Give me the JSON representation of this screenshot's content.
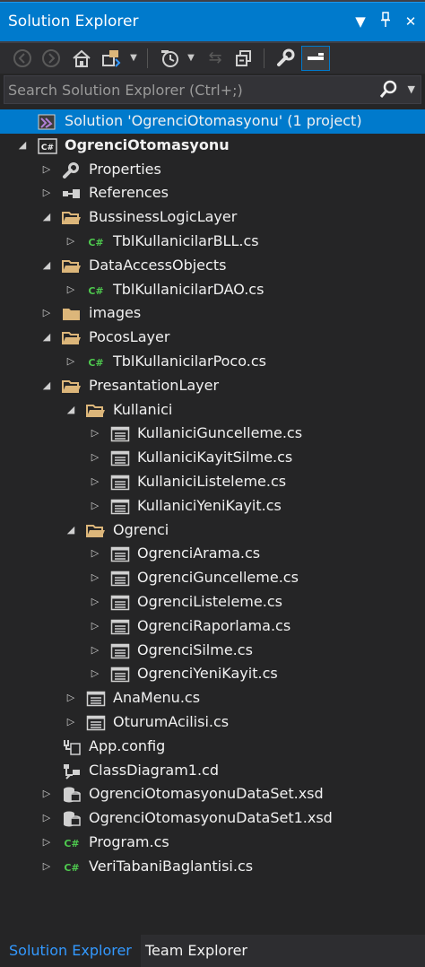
{
  "window": {
    "title": "Solution Explorer"
  },
  "search": {
    "placeholder": "Search Solution Explorer (Ctrl+;)"
  },
  "tree": [
    {
      "label": "Solution 'OgrenciOtomasyonu' (1 project)",
      "icon": "solution-icon",
      "expander": "none",
      "depth": 0,
      "selected": true
    },
    {
      "label": "OgrenciOtomasyonu",
      "icon": "csharp-project-icon",
      "expander": "expanded",
      "depth": 0,
      "bold": true
    },
    {
      "label": "Properties",
      "icon": "wrench-icon",
      "expander": "collapsed",
      "depth": 1
    },
    {
      "label": "References",
      "icon": "references-icon",
      "expander": "collapsed",
      "depth": 1
    },
    {
      "label": "BussinessLogicLayer",
      "icon": "folder-open-icon",
      "expander": "expanded",
      "depth": 1
    },
    {
      "label": "TblKullanicilarBLL.cs",
      "icon": "csharp-file-icon",
      "expander": "collapsed",
      "depth": 2
    },
    {
      "label": "DataAccessObjects",
      "icon": "folder-open-icon",
      "expander": "expanded",
      "depth": 1
    },
    {
      "label": "TblKullanicilarDAO.cs",
      "icon": "csharp-file-icon",
      "expander": "collapsed",
      "depth": 2
    },
    {
      "label": "images",
      "icon": "folder-icon",
      "expander": "collapsed",
      "depth": 1
    },
    {
      "label": "PocosLayer",
      "icon": "folder-open-icon",
      "expander": "expanded",
      "depth": 1
    },
    {
      "label": "TblKullanicilarPoco.cs",
      "icon": "csharp-file-icon",
      "expander": "collapsed",
      "depth": 2
    },
    {
      "label": "PresantationLayer",
      "icon": "folder-open-icon",
      "expander": "expanded",
      "depth": 1
    },
    {
      "label": "Kullanici",
      "icon": "folder-open-icon",
      "expander": "expanded",
      "depth": 2
    },
    {
      "label": "KullaniciGuncelleme.cs",
      "icon": "form-icon",
      "expander": "collapsed",
      "depth": 3
    },
    {
      "label": "KullaniciKayitSilme.cs",
      "icon": "form-icon",
      "expander": "collapsed",
      "depth": 3
    },
    {
      "label": "KullaniciListeleme.cs",
      "icon": "form-icon",
      "expander": "collapsed",
      "depth": 3
    },
    {
      "label": "KullaniciYeniKayit.cs",
      "icon": "form-icon",
      "expander": "collapsed",
      "depth": 3
    },
    {
      "label": "Ogrenci",
      "icon": "folder-open-icon",
      "expander": "expanded",
      "depth": 2
    },
    {
      "label": "OgrenciArama.cs",
      "icon": "form-icon",
      "expander": "collapsed",
      "depth": 3
    },
    {
      "label": "OgrenciGuncelleme.cs",
      "icon": "form-icon",
      "expander": "collapsed",
      "depth": 3
    },
    {
      "label": "OgrenciListeleme.cs",
      "icon": "form-icon",
      "expander": "collapsed",
      "depth": 3
    },
    {
      "label": "OgrenciRaporlama.cs",
      "icon": "form-icon",
      "expander": "collapsed",
      "depth": 3
    },
    {
      "label": "OgrenciSilme.cs",
      "icon": "form-icon",
      "expander": "collapsed",
      "depth": 3
    },
    {
      "label": "OgrenciYeniKayit.cs",
      "icon": "form-icon",
      "expander": "collapsed",
      "depth": 3
    },
    {
      "label": "AnaMenu.cs",
      "icon": "form-icon",
      "expander": "collapsed",
      "depth": 2
    },
    {
      "label": "OturumAcilisi.cs",
      "icon": "form-icon",
      "expander": "collapsed",
      "depth": 2
    },
    {
      "label": "App.config",
      "icon": "config-icon",
      "expander": "none",
      "depth": 1
    },
    {
      "label": "ClassDiagram1.cd",
      "icon": "class-diagram-icon",
      "expander": "none",
      "depth": 1
    },
    {
      "label": "OgrenciOtomasyonuDataSet.xsd",
      "icon": "dataset-icon",
      "expander": "collapsed",
      "depth": 1
    },
    {
      "label": "OgrenciOtomasyonuDataSet1.xsd",
      "icon": "dataset-icon",
      "expander": "collapsed",
      "depth": 1
    },
    {
      "label": "Program.cs",
      "icon": "csharp-file-icon",
      "expander": "collapsed",
      "depth": 1
    },
    {
      "label": "VeriTabaniBaglantisi.cs",
      "icon": "csharp-file-icon",
      "expander": "collapsed",
      "depth": 1
    }
  ],
  "tabs": [
    {
      "label": "Solution Explorer",
      "active": true
    },
    {
      "label": "Team Explorer",
      "active": false
    }
  ],
  "colors": {
    "accent": "#007acc",
    "background": "#252526",
    "toolbar": "#2d2d30",
    "folder": "#dcb67a",
    "csharp": "#4ec94e",
    "active_tab_text": "#3399ff"
  }
}
